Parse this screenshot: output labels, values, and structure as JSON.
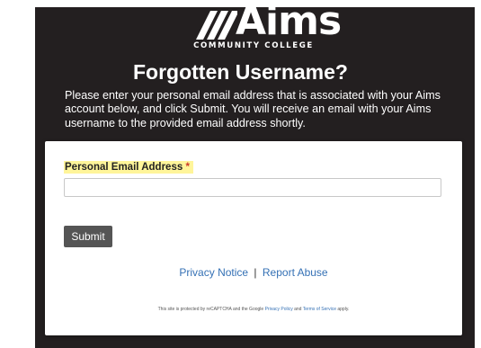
{
  "logo": {
    "wordmark": "Aims",
    "subtitle": "COMMUNITY COLLEGE"
  },
  "page": {
    "title": "Forgotten Username?",
    "intro": "Please enter your personal email address that is associated with your Aims account below, and click Submit. You will receive an email with your Aims username to the provided email address shortly."
  },
  "form": {
    "email_label": "Personal Email Address",
    "required_marker": "*",
    "email_value": "",
    "submit_label": "Submit"
  },
  "links": {
    "privacy_notice": "Privacy Notice",
    "separator": "|",
    "report_abuse": "Report Abuse"
  },
  "recaptcha": {
    "prefix": "This site is protected by reCAPTCHA and the Google",
    "privacy_policy": "Privacy Policy",
    "and": "and",
    "terms": "Terms of Service",
    "suffix": "apply."
  },
  "colors": {
    "panel_background": "#231f20",
    "label_highlight": "#fff59a",
    "link": "#3571b5",
    "button": "#555555",
    "required": "#cc3a2a"
  }
}
